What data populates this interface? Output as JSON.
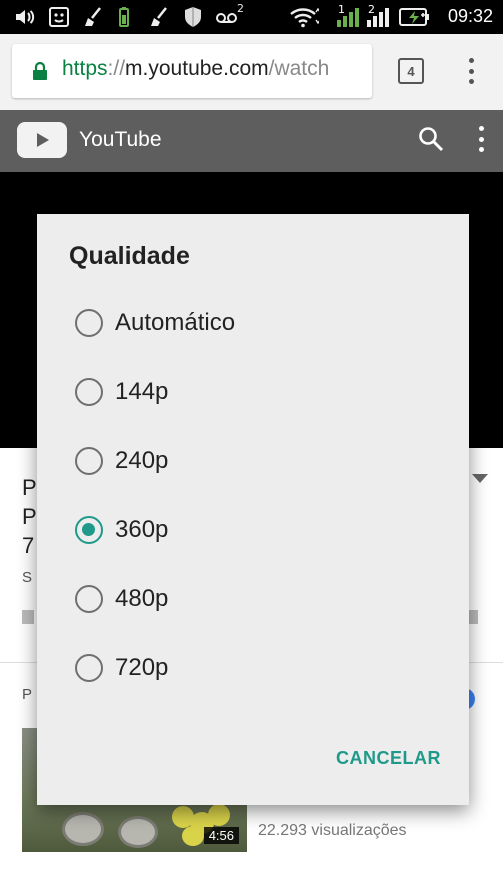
{
  "status_bar": {
    "time": "09:32",
    "icons": [
      "volume-icon",
      "face-icon",
      "broom-icon",
      "battery-small-icon",
      "broom-icon",
      "shield-icon",
      "voicemail-icon",
      "wifi-icon",
      "signal-1-icon",
      "signal-2-icon",
      "battery-charging-icon"
    ],
    "voicemail_count": "2",
    "sim1_label": "1",
    "sim2_label": "2"
  },
  "browser": {
    "url_scheme": "https",
    "url_separator": "://",
    "url_host": "m.youtube.com",
    "url_path": "/watch",
    "tab_count": "4",
    "secure_color": "#0b8043"
  },
  "youtube_header": {
    "title": "YouTube"
  },
  "background": {
    "line1": "P",
    "line2": "P",
    "line3": "7",
    "line4": "S",
    "related_label": "P",
    "duration": "4:56",
    "views": "22.293 visualizações"
  },
  "dialog": {
    "title": "Qualidade",
    "options": [
      {
        "label": "Automático",
        "selected": false
      },
      {
        "label": "144p",
        "selected": false
      },
      {
        "label": "240p",
        "selected": false
      },
      {
        "label": "360p",
        "selected": true
      },
      {
        "label": "480p",
        "selected": false
      },
      {
        "label": "720p",
        "selected": false
      }
    ],
    "cancel_label": "CANCELAR",
    "accent_color": "#1f9a8a"
  }
}
